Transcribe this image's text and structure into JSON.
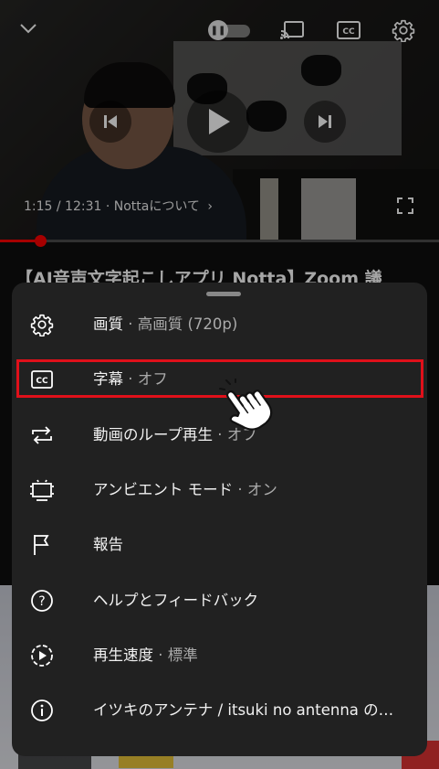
{
  "player": {
    "time_display": "1:15 / 12:31 · Nottaについて",
    "chapter_chevron": "›",
    "progress_fraction": 0.092
  },
  "video": {
    "title": "【AI音声文字起こしアプリ Notta】Zoom 議"
  },
  "icons": {
    "collapse": "chevron-down-icon",
    "autoplay": "pause-toggle-icon",
    "cast": "cast-icon",
    "captions": "cc-icon",
    "settings": "gear-icon",
    "previous": "skip-previous-icon",
    "play": "play-icon",
    "next": "skip-next-icon",
    "fullscreen": "fullscreen-icon"
  },
  "menu": {
    "items": [
      {
        "icon": "gear-icon",
        "label": "画質",
        "value": "高画質 (720p)"
      },
      {
        "icon": "cc-icon",
        "label": "字幕",
        "value": "オフ"
      },
      {
        "icon": "loop-icon",
        "label": "動画のループ再生",
        "value": "オフ"
      },
      {
        "icon": "ambient-tv-icon",
        "label": "アンビエント モード",
        "value": "オン"
      },
      {
        "icon": "flag-icon",
        "label": "報告",
        "value": ""
      },
      {
        "icon": "help-icon",
        "label": "ヘルプとフィードバック",
        "value": ""
      },
      {
        "icon": "playback-speed-icon",
        "label": "再生速度",
        "value": "標準"
      },
      {
        "icon": "info-icon",
        "label": "イツキのアンテナ / itsuki no antenna の…",
        "value": ""
      }
    ],
    "separator": " · ",
    "highlighted_index": 1
  },
  "colors": {
    "accent_red": "#ff0000",
    "highlight_border": "#e0101a",
    "sheet_bg": "#212121"
  }
}
